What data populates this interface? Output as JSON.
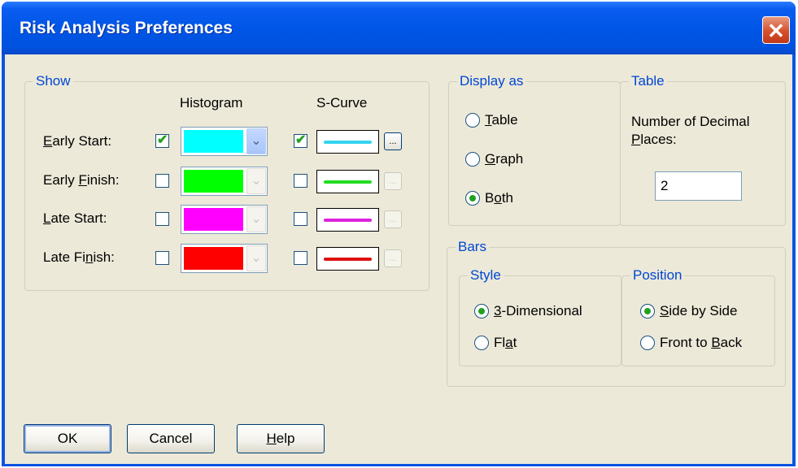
{
  "window": {
    "title": "Risk Analysis Preferences",
    "close_glyph": "✕"
  },
  "show": {
    "legend": "Show",
    "col_histogram": "Histogram",
    "col_scurve": "S-Curve",
    "check_glyph": "✔",
    "combo_arrow_glyph": "⌄",
    "dots_glyph": "...",
    "rows": [
      {
        "label_pre": "",
        "label_u": "E",
        "label_post": "arly Start:",
        "histogram_checked": true,
        "color": "#00ffff",
        "scurve_checked": true,
        "line_color": "#33d4ee",
        "enabled": true
      },
      {
        "label_pre": "Early ",
        "label_u": "F",
        "label_post": "inish:",
        "histogram_checked": false,
        "color": "#00ff00",
        "scurve_checked": false,
        "line_color": "#22dd22",
        "enabled": false
      },
      {
        "label_pre": "",
        "label_u": "L",
        "label_post": "ate Start:",
        "histogram_checked": false,
        "color": "#ff00ff",
        "scurve_checked": false,
        "line_color": "#dd22dd",
        "enabled": false
      },
      {
        "label_pre": "Late Fi",
        "label_u": "n",
        "label_post": "ish:",
        "histogram_checked": false,
        "color": "#ff0000",
        "scurve_checked": false,
        "line_color": "#dd1111",
        "enabled": false
      }
    ]
  },
  "display_as": {
    "legend": "Display as",
    "options": [
      {
        "pre": "",
        "u": "T",
        "post": "able",
        "selected": false
      },
      {
        "pre": "",
        "u": "G",
        "post": "raph",
        "selected": false
      },
      {
        "pre": "B",
        "u": "o",
        "post": "th",
        "selected": true
      }
    ]
  },
  "table": {
    "legend": "Table",
    "label_line1": "Number of Decimal",
    "label_line2_u": "P",
    "label_line2_post": "laces:",
    "decimal_places": "2"
  },
  "bars": {
    "legend": "Bars",
    "style": {
      "legend": "Style",
      "options": [
        {
          "pre": "",
          "u": "3",
          "post": "-Dimensional",
          "selected": true
        },
        {
          "pre": "Fl",
          "u": "a",
          "post": "t",
          "selected": false
        }
      ]
    },
    "position": {
      "legend": "Position",
      "options": [
        {
          "pre": "",
          "u": "S",
          "post": "ide by Side",
          "selected": true
        },
        {
          "pre": "Front to ",
          "u": "B",
          "post": "ack",
          "selected": false
        }
      ]
    }
  },
  "buttons": {
    "ok": "OK",
    "cancel": "Cancel",
    "help_u": "H",
    "help_post": "elp"
  }
}
